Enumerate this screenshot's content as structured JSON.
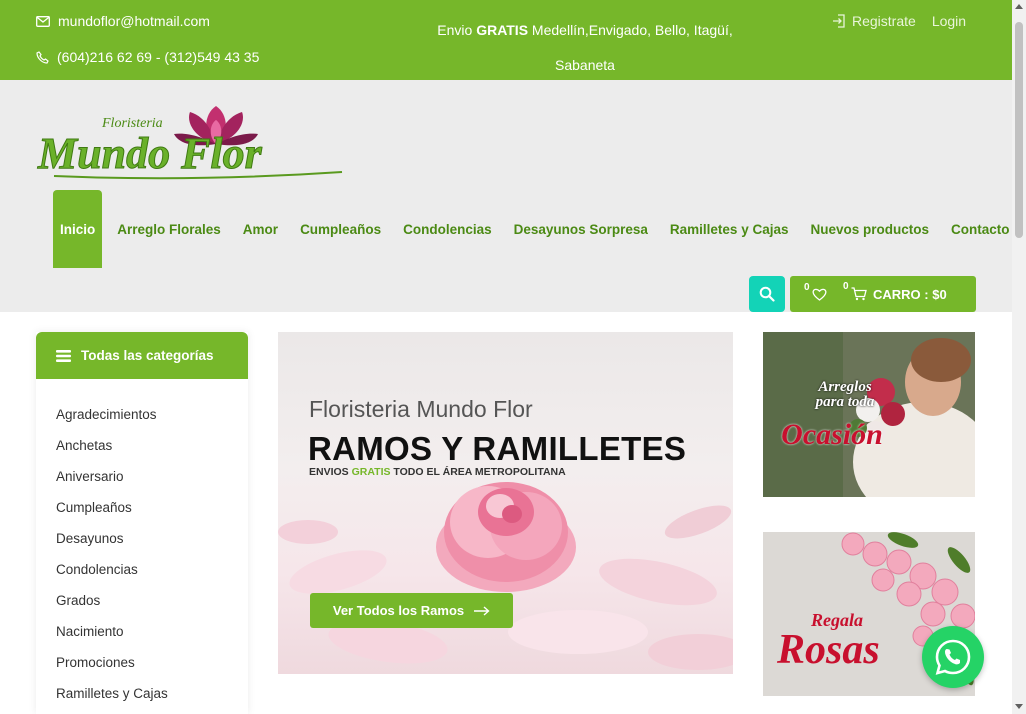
{
  "topbar": {
    "email": "mundoflor@hotmail.com",
    "phone": "(604)216 62 69 - (312)549 43 35",
    "ship_prefix": "Envio ",
    "ship_bold": "GRATIS",
    "ship_rest": " Medellín,Envigado, Bello, Itagüí,",
    "ship_line2": "Sabaneta",
    "register": "Registrate",
    "login": "Login"
  },
  "logo": {
    "small_text": "Floristeria",
    "main_text": "Mundo Flor"
  },
  "nav": {
    "items": [
      {
        "label": "Inicio"
      },
      {
        "label": "Arreglo Florales"
      },
      {
        "label": "Amor"
      },
      {
        "label": "Cumpleaños"
      },
      {
        "label": "Condolencias"
      },
      {
        "label": "Desayunos Sorpresa"
      },
      {
        "label": "Ramilletes y Cajas"
      },
      {
        "label": "Nuevos productos"
      },
      {
        "label": "Contacto"
      }
    ]
  },
  "cart": {
    "wish_count": "0",
    "cart_count": "0",
    "label": "CARRO : $0"
  },
  "sidebar": {
    "title": "Todas las categorías",
    "items": [
      {
        "label": "Agradecimientos"
      },
      {
        "label": "Anchetas"
      },
      {
        "label": "Aniversario"
      },
      {
        "label": "Cumpleaños"
      },
      {
        "label": "Desayunos"
      },
      {
        "label": "Condolencias"
      },
      {
        "label": "Grados"
      },
      {
        "label": "Nacimiento"
      },
      {
        "label": "Promociones"
      },
      {
        "label": "Ramilletes y Cajas"
      }
    ]
  },
  "hero": {
    "subtitle": "Floristeria Mundo Flor",
    "title": "RAMOS Y RAMILLETES",
    "ship_a": "ENVIOS ",
    "ship_b": "GRATIS",
    "ship_c": " TODO EL ÁREA METROPOLITANA",
    "button": "Ver Todos los Ramos"
  },
  "banners": {
    "b1_line1": "Arreglos",
    "b1_line2": "para toda",
    "b1_line3": "Ocasión",
    "b2_line1": "Regala",
    "b2_line2": "Rosas"
  },
  "colors": {
    "brand_green": "#76b72a",
    "accent_teal": "#13d3b7",
    "whatsapp": "#25d366"
  }
}
